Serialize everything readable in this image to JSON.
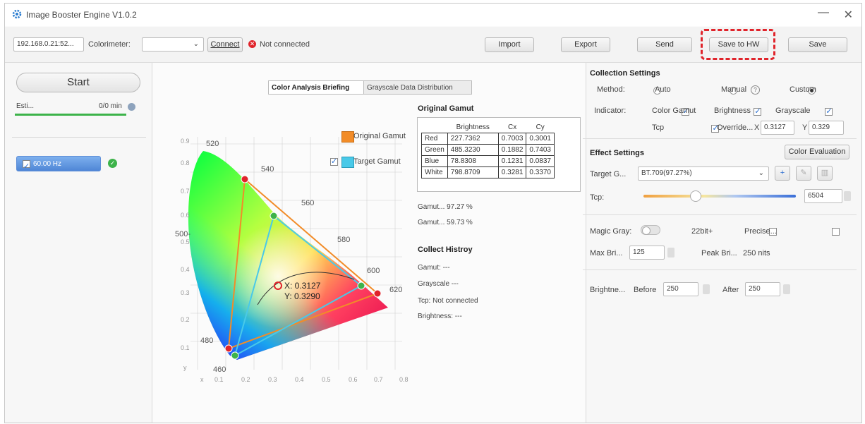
{
  "window": {
    "title": "Image Booster Engine  V1.0.2"
  },
  "toolbar": {
    "ip": "192.168.0.21:52...",
    "colorimeter_label": "Colorimeter:",
    "colorimeter_value": "",
    "connect_label": "Connect",
    "status_text": "Not connected",
    "import_label": "Import",
    "export_label": "Export",
    "send_label": "Send",
    "save_hw_label": "Save to HW",
    "save_label": "Save"
  },
  "left": {
    "start_label": "Start",
    "est_label": "Esti...",
    "est_value": "0/0 min",
    "hz_label": "60.00 Hz"
  },
  "center": {
    "tabs": [
      "Color Analysis Briefing",
      "Grayscale Data Distribution"
    ],
    "legend": {
      "original": "Original Gamut",
      "target": "Target Gamut"
    },
    "wp_x": "X:  0.3127",
    "wp_y": "Y:  0.3290",
    "wavelengths": [
      "520",
      "540",
      "560",
      "580",
      "600",
      "620",
      "480",
      "460",
      "500-"
    ],
    "y_ticks": [
      "0.9",
      "0.8",
      "0.7",
      "0.6",
      "0.5",
      "0.4",
      "0.3",
      "0.2",
      "0.1",
      "y"
    ],
    "x_ticks": [
      "x",
      "0.1",
      "0.2",
      "0.3",
      "0.4",
      "0.5",
      "0.6",
      "0.7",
      "0.8"
    ]
  },
  "gamut": {
    "title": "Original Gamut",
    "headers": [
      "",
      "Brightness",
      "Cx",
      "Cy"
    ],
    "rows": [
      [
        "Red",
        "227.7362",
        "0.7003",
        "0.3001"
      ],
      [
        "Green",
        "485.3230",
        "0.1882",
        "0.7403"
      ],
      [
        "Blue",
        "78.8308",
        "0.1231",
        "0.0837"
      ],
      [
        "White",
        "798.8709",
        "0.3281",
        "0.3370"
      ]
    ],
    "gamut1": "Gamut... 97.27 %",
    "gamut2": "Gamut... 59.73 %",
    "collect_title": "Collect Histroy",
    "collect_gamut": "Gamut: ---",
    "collect_gray": "Grayscale ---",
    "collect_tcp": "Tcp: Not connected",
    "collect_bright": "Brightness: ---"
  },
  "settings": {
    "collection_title": "Collection Settings",
    "method_label": "Method:",
    "method_auto": "Auto",
    "method_manual": "Manual",
    "method_custom": "Custom",
    "indicator_label": "Indicator:",
    "ind_gamut": "Color Gamut",
    "ind_bright": "Brightness",
    "ind_gray": "Grayscale",
    "ind_tcp": "Tcp",
    "ind_override": "Override...",
    "x_label": "X",
    "x_value": "0.3127",
    "y_label": "Y",
    "y_value": "0.329",
    "effect_title": "Effect Settings",
    "color_eval_label": "Color Evaluation",
    "target_label": "Target G...",
    "target_value": "BT.709(97.27%)",
    "tcp_label": "Tcp:",
    "tcp_value": "6504",
    "tcp_slider": 0.34,
    "magic_label": "Magic Gray:",
    "bit_label": "22bit+",
    "precise_label": "Precise...",
    "maxbri_label": "Max Bri...",
    "maxbri_value": "125",
    "peak_label": "Peak Bri...",
    "peak_value": "250 nits",
    "bright_label": "Brightne...",
    "before_label": "Before",
    "before_value": "250",
    "after_label": "After",
    "after_value": "250"
  },
  "colors": {
    "highlight": "#e0242b",
    "accent": "#2f6fd1",
    "green": "#3db34a"
  }
}
